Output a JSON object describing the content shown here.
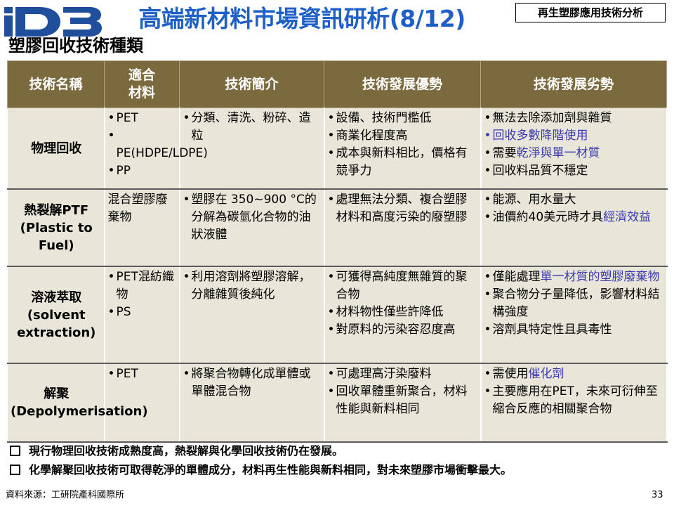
{
  "header": {
    "logo_text": "ID3",
    "title": "高端新材料市場資訊研析(8/12)",
    "tag": "再生塑膠應用技術分析"
  },
  "subtitle": "塑膠回收技術種類",
  "table": {
    "headers": [
      "技術名稱",
      "適合材料",
      "技術簡介",
      "技術發展優勢",
      "技術發展劣勢"
    ],
    "rows": [
      {
        "name": "物理回收",
        "materials": [
          "PET",
          "PE(HDPE/LDPE)",
          "PP"
        ],
        "intro": [
          "分類、清洗、粉碎、造粒"
        ],
        "advantages": [
          "設備、技術門檻低",
          "商業化程度高",
          "成本與新料相比，價格有競爭力"
        ],
        "disadvantages": {
          "d1": "無法去除添加劑與雜質",
          "d2": "回收多數降階使用",
          "d3_prefix": "需要",
          "d3_highlight": "乾淨與單一材質",
          "d4": "回收料品質不穩定"
        }
      },
      {
        "name": "熱裂解PTF (Plastic to Fuel)",
        "materials_text": "混合塑膠廢棄物",
        "intro": [
          "塑膠在 350~900 °C的分解為碳氫化合物的油狀液體"
        ],
        "advantages": [
          "處理無法分類、複合塑膠材料和高度污染的廢塑膠"
        ],
        "disadvantages": {
          "d1": "能源、用水量大",
          "d2_prefix": "油價約40美元時才具",
          "d2_highlight": "經濟效益"
        }
      },
      {
        "name": "溶液萃取 (solvent extraction)",
        "materials": [
          "PET混紡織物",
          "PS"
        ],
        "intro": [
          "利用溶劑將塑膠溶解，分離雜質後純化"
        ],
        "advantages": [
          "可獲得高純度無雜質的聚合物",
          "材料物性僅些許降低",
          "對原料的污染容忍度高"
        ],
        "disadvantages": {
          "d1_prefix": "僅能處理",
          "d1_highlight": "單一材質的塑膠廢棄物",
          "d2": "聚合物分子量降低，影響材料結構強度",
          "d3": "溶劑具特定性且具毒性"
        }
      },
      {
        "name": "解聚 (Depolymerisation)",
        "materials": [
          "PET"
        ],
        "intro": [
          "將聚合物轉化成單體或單體混合物"
        ],
        "advantages": [
          "可處理高汙染廢料",
          "回收單體重新聚合，材料性能與新料相同"
        ],
        "disadvantages": {
          "d1_prefix": "需使用",
          "d1_highlight": "催化劑",
          "d2": "主要應用在PET，未來可衍伸至縮合反應的相關聚合物"
        }
      }
    ]
  },
  "notes": [
    "現行物理回收技術成熟度高，熱裂解與化學回收技術仍在發展。",
    "化學解聚回收技術可取得乾淨的單體成分，材料再生性能與新料相同，對未來塑膠市場衝擊最大。"
  ],
  "footer": {
    "source": "資料來源：工研院產科國際所",
    "page": "33"
  },
  "colors": {
    "title": "#1f5fc8",
    "header_bg": "#7b6a3e",
    "cell_bg": "#e9e5d8",
    "highlight": "#3a3ab0",
    "logo_blue": "#1f4f9c"
  }
}
